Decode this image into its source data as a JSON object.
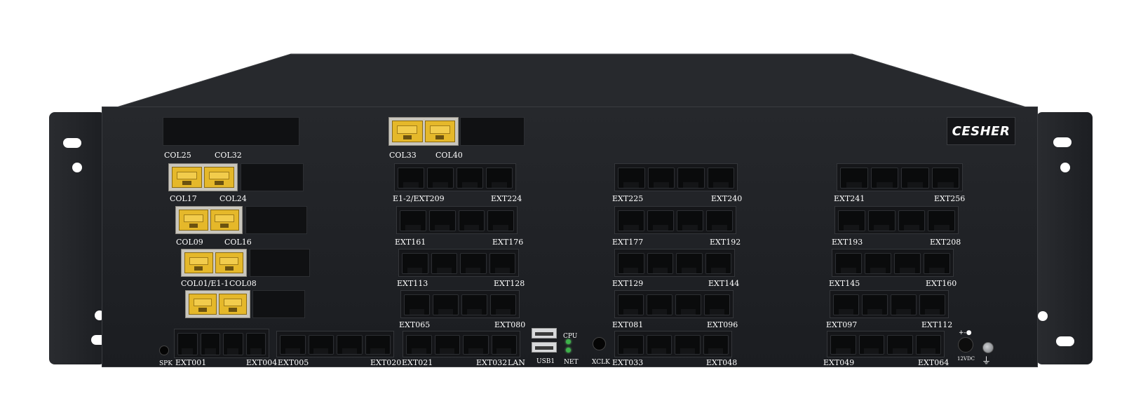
{
  "device": {
    "brand": "CESHER"
  },
  "col_labels": {
    "col25": "COL25",
    "col32": "COL32",
    "col33": "COL33",
    "col40": "COL40",
    "col17": "COL17",
    "col24": "COL24",
    "col09": "COL09",
    "col16": "COL16",
    "col01": "COL01/E1-1",
    "col08": "COL08"
  },
  "ext_labels": {
    "e1_2": "E1-2/EXT209",
    "ext224": "EXT224",
    "ext225": "EXT225",
    "ext240": "EXT240",
    "ext241": "EXT241",
    "ext256": "EXT256",
    "ext161": "EXT161",
    "ext176": "EXT176",
    "ext177": "EXT177",
    "ext192": "EXT192",
    "ext193": "EXT193",
    "ext208": "EXT208",
    "ext113": "EXT113",
    "ext128": "EXT128",
    "ext129": "EXT129",
    "ext144": "EXT144",
    "ext145": "EXT145",
    "ext160": "EXT160",
    "ext065": "EXT065",
    "ext080": "EXT080",
    "ext081": "EXT081",
    "ext096": "EXT096",
    "ext097": "EXT097",
    "ext112": "EXT112",
    "ext001": "EXT001",
    "ext004": "EXT004",
    "ext005": "EXT005",
    "ext020": "EXT020",
    "ext021": "EXT021",
    "ext032": "EXT032",
    "ext033": "EXT033",
    "ext048": "EXT048",
    "ext049": "EXT049",
    "ext064": "EXT064"
  },
  "io_labels": {
    "spk": "SPK",
    "lan": "LAN",
    "usb1": "USB1",
    "cpu": "CPU",
    "net": "NET",
    "xclk": "XCLK",
    "power": "12VDC"
  },
  "colors": {
    "panel": "#1f2125",
    "sfp_module": "#e5b82a",
    "led": "#3db34a"
  },
  "icons": {
    "ground": "ground-symbol-icon",
    "power_polarity": "dc-polarity-icon"
  }
}
